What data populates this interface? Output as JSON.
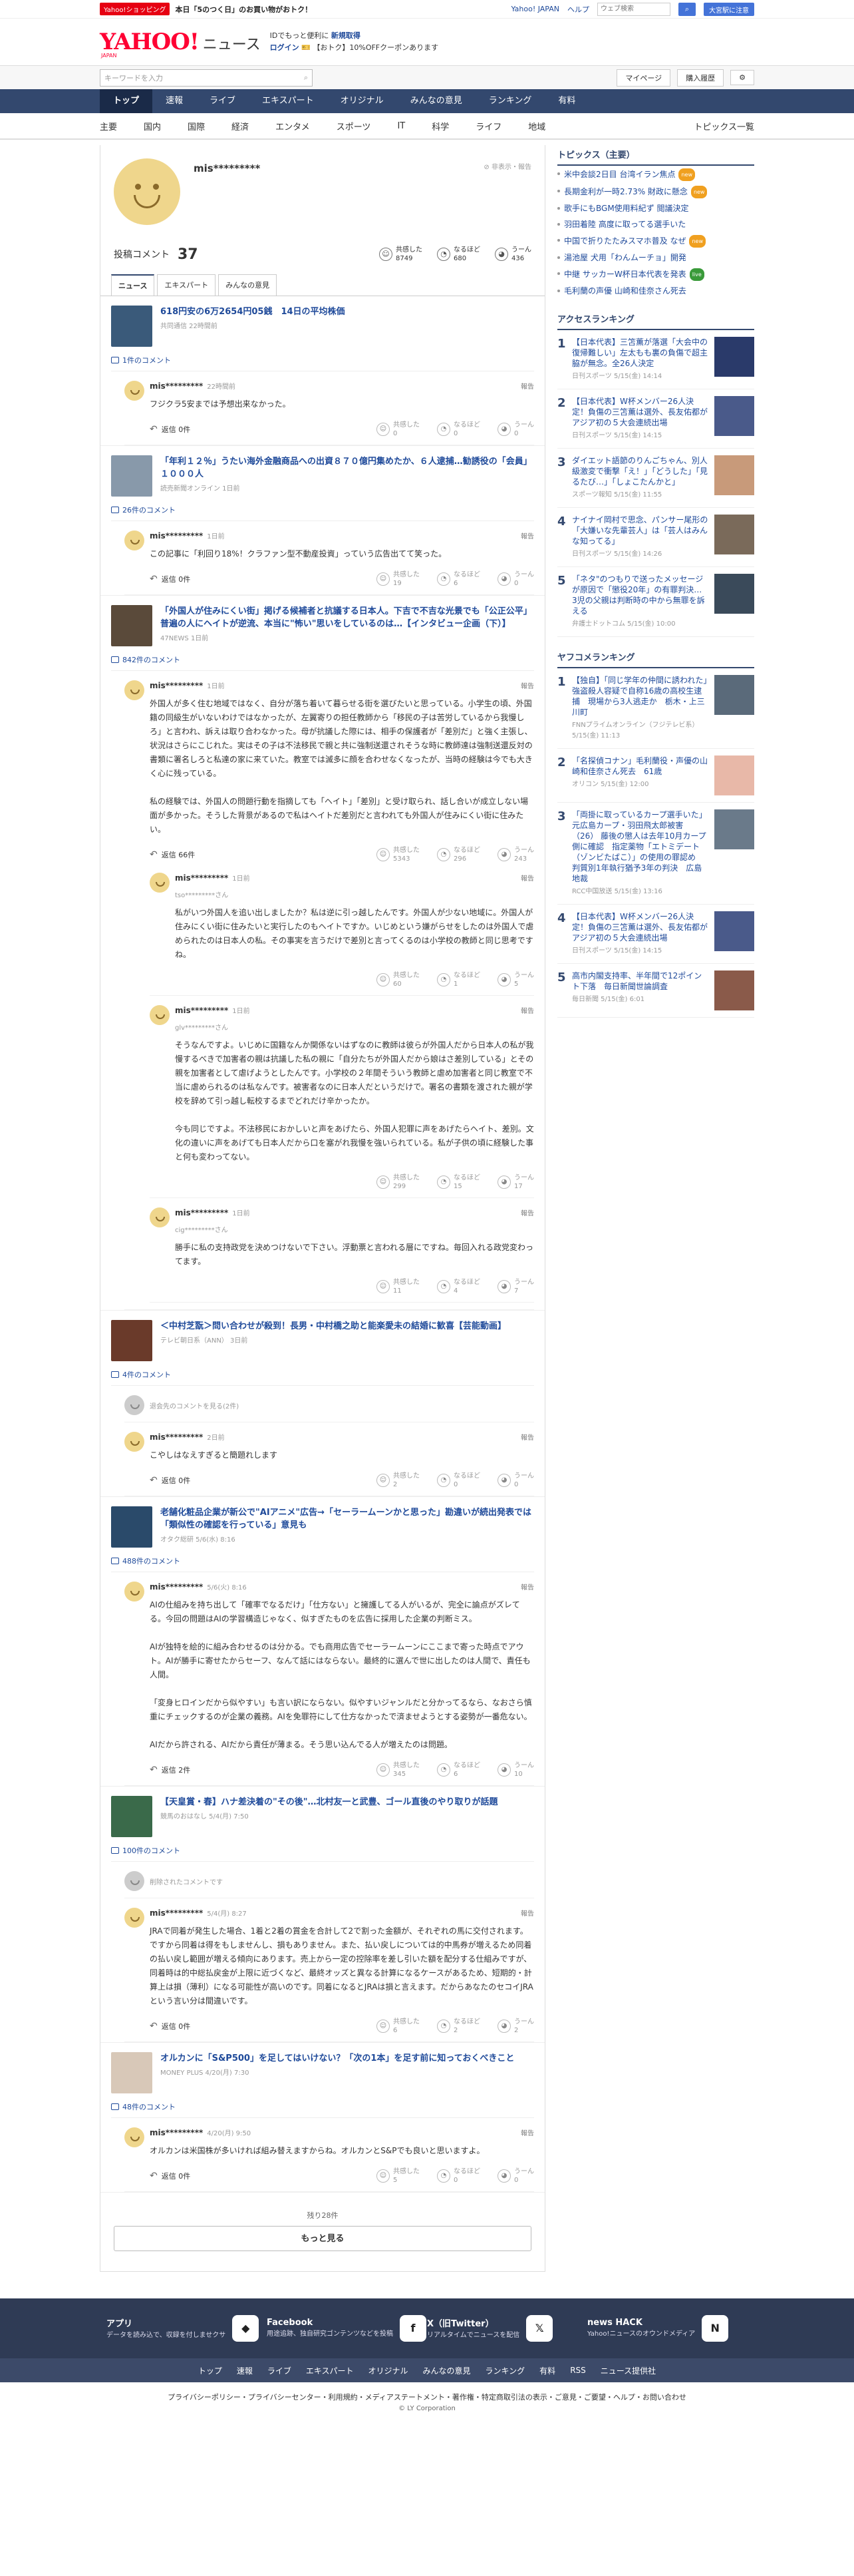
{
  "topbar": {
    "badge": "Yahoo!ショッピング",
    "promo": "本日「5のつく日」のお買い物がおトク！",
    "links": [
      "Yahoo! JAPAN",
      "ヘルプ"
    ],
    "search_placeholder": "ウェブ検索",
    "mail_btn": "大宮駅に注意"
  },
  "header": {
    "logo": "YAHOO!",
    "logo_jp": "JAPAN",
    "logo_sub": "ニュース",
    "promo1": "IDでもっと便利に",
    "promo1_link": "新規取得",
    "promo2": "ログイン",
    "promo2_rest": "【おトク】10%OFFクーポンあります"
  },
  "search": {
    "placeholder": "キーワードを入力",
    "links": [
      "マイページ",
      "購入履歴"
    ]
  },
  "gnav": [
    "トップ",
    "速報",
    "ライブ",
    "エキスパート",
    "オリジナル",
    "みんなの意見",
    "ランキング",
    "有料"
  ],
  "subnav": [
    "主要",
    "国内",
    "国際",
    "経済",
    "エンタメ",
    "スポーツ",
    "IT",
    "科学",
    "ライフ",
    "地域"
  ],
  "subnav_right": "トピックス一覧",
  "profile": {
    "name": "mis*********",
    "meta": "非表示・報告",
    "comment_label": "投稿コメント",
    "comment_count": "37",
    "reactions": [
      {
        "icon": "☺",
        "label": "共感した",
        "value": "8749"
      },
      {
        "icon": "◔",
        "label": "なるほど",
        "value": "680"
      },
      {
        "icon": "◕",
        "label": "うーん",
        "value": "436"
      }
    ],
    "tabs": [
      "ニュース",
      "エキスパート",
      "みんなの意見"
    ]
  },
  "articles": [
    {
      "title": "618円安の6万2654円05銭　14日の平均株価",
      "source": "共同通信 22時間前",
      "thumb": "#3a5a7a",
      "comment_count": "1件のコメント",
      "comments": [
        {
          "user": "mis*********",
          "time": "22時間前",
          "text": "フジクラ5安までは予想出来なかった。",
          "r": [
            "0",
            "0",
            "0"
          ],
          "reply": "返信 0件"
        }
      ]
    },
    {
      "title": "「年利１２％」うたい海外金融商品への出資８７０億円集めたか、６人逮捕…勧誘役の「会員」１０００人",
      "source": "読売新聞オンライン 1日前",
      "thumb": "#8899aa",
      "comment_count": "26件のコメント",
      "comments": [
        {
          "user": "mis*********",
          "time": "1日前",
          "text": "この記事に「利回り18%！クラファン型不動産投資」っていう広告出てて笑った。",
          "r": [
            "19",
            "6",
            "0"
          ],
          "reply": "返信 0件"
        }
      ]
    },
    {
      "title": "「外国人が住みにくい街」掲げる候補者と抗議する日本人。下吉で不吉な光景でも「公正公平」普遍の人にヘイトが逆流、本当に\"怖い\"思いをしているのは…【インタビュー企画（下）】",
      "source": "47NEWS 1日前",
      "thumb": "#5a4a3a",
      "comment_count": "842件のコメント",
      "comments": [
        {
          "user": "mis*********",
          "time": "1日前",
          "text": "外国人が多く住む地域ではなく、自分が落ち着いて暮らせる街を選びたいと思っている。小学生の頃、外国籍の同級生がいないわけではなかったが、左翼寄りの担任教師から「移民の子は苦労しているから我慢しろ」と言われ、訴えは取り合わなかった。母が抗議した際には、相手の保護者が「差別だ」と強く主張し、状況はさらにこじれた。実はその子は不法移民で親と共に強制送還されそうな時に教師達は強制送還反対の書類に署名しろと私達の家に来ていた。教室では滅多に顔を合わせなくなったが、当時の経験は今でも大きく心に残っている。\n\n私の経験では、外国人の問題行動を指摘しても「ヘイト」「差別」と受け取られ、話し合いが成立しない場面が多かった。そうした背景があるので私はヘイトだ差別だと言われても外国人が住みにくい街に住みたい。",
          "r": [
            "5343",
            "296",
            "243"
          ],
          "reply": "返信 66件",
          "replies": [
            {
              "user": "tso*********さん",
              "text": "私がいつ外国人を追い出しましたか？私は逆に引っ越したんです。外国人が少ない地域に。外国人が住みにくい街に住みたいと実行したのもヘイトですか。いじめという嫌がらせをしたのは外国人で虐められたのは日本人の私。その事実を言うだけで差別と言ってくるのは小学校の教師と同じ思考ですね。",
              "r": [
                "60",
                "1",
                "5"
              ]
            },
            {
              "user": "glv*********さん",
              "text": "そうなんですよ。いじめに国籍なんか関係ないはずなのに教師は彼らが外国人だから日本人の私が我慢するべきで加害者の親は抗議した私の親に「自分たちが外国人だから娘はさ差別している」とその親を加害者として虐げようとしたんです。小学校の２年間そういう教師と虐め加害者と同じ教室で不当に虐められるのは私なんです。被害者なのに日本人だというだけで。署名の書類を渡された親が学校を辞めて引っ越し転校するまでどれだけ辛かったか。\n\n今も同じですよ。不法移民におかしいと声をあげたら、外国人犯罪に声をあげたらヘイト、差別。文化の違いに声をあげても日本人だから口を塞がれ我慢を強いられている。私が子供の頃に経験した事と何も変わってない。",
              "r": [
                "299",
                "15",
                "17"
              ]
            },
            {
              "user": "cig*********さん",
              "text": "勝手に私の支持政党を決めつけないで下さい。浮動票と言われる層にですね。毎回入れる政党変わってます。",
              "r": [
                "11",
                "4",
                "7"
              ]
            }
          ]
        }
      ]
    },
    {
      "title": "＜中村芝翫＞問い合わせが殺到！長男・中村橋之助と能楽愛未の結婚に歓喜【芸能動画】",
      "source": "テレビ朝日系（ANN） 3日前",
      "thumb": "#6a3a2a",
      "comment_count": "4件のコメント",
      "deleted": "退会先のコメントを見る(2件)",
      "comments": [
        {
          "user": "mis*********",
          "time": "2日前",
          "text": "こやしはなえすぎると簡題れします",
          "r": [
            "2",
            "0",
            "0"
          ],
          "reply": "返信 0件"
        }
      ]
    },
    {
      "title": "老舗化粧品企業が新公で\"AIアニメ\"広告→「セーラームーンかと思った」勘違いが続出発表では「類似性の確認を行っている」意見も",
      "source": "オタク総研 5/6(水) 8:16",
      "thumb": "#2a4a6a",
      "comment_count": "488件のコメント",
      "comments": [
        {
          "user": "mis*********",
          "time": "5/6(火) 8:16",
          "text": "AIの仕組みを持ち出して「確率でなるだけ」「仕方ない」と擁護してる人がいるが、完全に論点がズレてる。今回の問題はAIの学習構造じゃなく、似すぎたものを広告に採用した企業の判断ミス。\n\nAIが独特を絵的に組み合わせるのは分かる。でも商用広告でセーラームーンにここまで寄った時点でアウト。AIが勝手に寄せたからセーフ、なんて話にはならない。最終的に選んで世に出したのは人間で、責任も人間。\n\n「変身ヒロインだから似やすい」も言い訳にならない。似やすいジャンルだと分かってるなら、なおさら慎重にチェックするのが企業の義務。AIを免罪符にして仕方なかったで済ませようとする姿勢が一番危ない。\n\nAIだから許される、AIだから責任が薄まる。そう思い込んでる人が増えたのは問題。",
          "r": [
            "345",
            "6",
            "10"
          ],
          "reply": "返信 2件"
        }
      ]
    },
    {
      "title": "【天皇賞・春】ハナ差決着の\"その後\"…北村友一と武豊、ゴール直後のやり取りが話題",
      "source": "競馬のおはなし 5/4(月) 7:50",
      "thumb": "#3a6a4a",
      "comment_count": "100件のコメント",
      "deleted": "削除されたコメントです",
      "comments": [
        {
          "user": "mis*********",
          "time": "5/4(月) 8:27",
          "text": "JRAで同着が発生した場合、1着と2着の賞金を合計して2で割った金額が、それぞれの馬に交付されます。ですから同着は得をもしませんし、損もありません。また、払い戻しについては的中馬券が増えるため同着の払い戻し範囲が増える傾向にあります。売上から一定の控除率を差し引いた額を配分する仕組みですが、同着時は的中総払戻金が上限に近づくなど、最終オッズと異なる計算になるケースがあるため、短期的・計算上は損（薄利）になる可能性が高いのです。同着になるとJRAは損と言えます。だからあなたのセコイJRAという言い分は間違いです。",
          "r": [
            "6",
            "2",
            "2"
          ],
          "reply": "返信 0件"
        }
      ]
    },
    {
      "title": "オルカンに「S&P500」を足してはいけない？「次の1本」を足す前に知っておくべきこと",
      "source": "MONEY PLUS 4/20(月) 7:30",
      "thumb": "#d8c8b8",
      "comment_count": "48件のコメント",
      "comments": [
        {
          "user": "mis*********",
          "time": "4/20(月) 9:50",
          "text": "オルカンは米国株が多いければ組み替えますからね。オルカンとS&Pでも良いと思いますよ。",
          "r": [
            "5",
            "0",
            "0"
          ],
          "reply": "返信 0件"
        }
      ]
    }
  ],
  "more": {
    "rest": "残り28件",
    "button": "もっと見る"
  },
  "side": {
    "topics_title": "トピックス（主要）",
    "topics": [
      {
        "t": "米中会談2日目 台湾イラン焦点",
        "b": "new",
        "c": "#f0a020"
      },
      {
        "t": "長期金利が一時2.73% 財政に懸念",
        "b": "new",
        "c": "#f0a020"
      },
      {
        "t": "歌手にもBGM使用料紀ず 閲議決定",
        "b": "",
        "c": ""
      },
      {
        "t": "羽田着陸 高度に取ってる選手いた",
        "b": "",
        "c": ""
      },
      {
        "t": "中国で折りたたみスマホ普及 なぜ",
        "b": "new",
        "c": "#f0a020"
      },
      {
        "t": "湯池屋 犬用「わんムーチョ」開発",
        "b": "",
        "c": ""
      },
      {
        "t": "中継 サッカーW杯日本代表を発表",
        "b": "live",
        "c": "#3a9a3a"
      },
      {
        "t": "毛利蘭の声優 山崎和佳奈さん死去",
        "b": "",
        "c": ""
      }
    ],
    "access_title": "アクセスランキング",
    "access": [
      {
        "t": "【日本代表】三笘薫が落選「大会中の復帰難しい」左太もも裏の負傷で超主脇が無念。全26人決定",
        "s": "日刊スポーツ 5/15(金) 14:14",
        "c": "#2a3a6a"
      },
      {
        "t": "【日本代表】W杯メンバー26人決定！負傷の三笘薫は選外、長友佑都がアジア初の５大会連続出場",
        "s": "日刊スポーツ 5/15(金) 14:15",
        "c": "#4a5a8a"
      },
      {
        "t": "ダイエット語節のりんごちゃん、別人級激変で衝撃「え！」「どうした」「見るたび…」「しょこたんかと」",
        "s": "スポーツ報知 5/15(金) 11:55",
        "c": "#c89a7a"
      },
      {
        "t": "ナイナイ岡村で思念、パンサー尾形の「大嫌いな先輩芸人」は「芸人はみんな知ってる」",
        "s": "日刊スポーツ 5/15(金) 14:26",
        "c": "#7a6a5a"
      },
      {
        "t": "「ネタ\"のつもりで送ったメッセージが原因で「懲役20年」の有罪判決… 3児の父親は判断時の中から無罪を訴える",
        "s": "弁護士ドットコム 5/15(金) 10:00",
        "c": "#3a4a5a"
      }
    ],
    "yahoo_title": "ヤフコメランキング",
    "yahoo": [
      {
        "t": "【独自】「同じ学年の仲間に誘われた」強盗殺人容疑で自称16歳の高校生逮捕　現場から3人逃走か　栃木・上三川町",
        "s": "FNNプライムオンライン（フジテレビ系） 5/15(金) 11:13",
        "c": "#5a6a7a"
      },
      {
        "t": "「名探偵コナン」毛利蘭役・声優の山崎和佳奈さん死去　61歳",
        "s": "オリコン 5/15(金) 12:00",
        "c": "#e8b8a8"
      },
      {
        "t": "「両掛に取っているカープ選手いた」元広島カープ・羽田飛太郎被害（26） 藤後の懲人は去年10月カープ側に確認　指定薬物「エトミデート（ゾンビたばこ）」の使用の罪認め　判質別1年執行猶予3年の判決　広島地裁",
        "s": "RCC中国放送 5/15(金) 13:16",
        "c": "#6a7a8a"
      },
      {
        "t": "【日本代表】W杯メンバー26人決定！負傷の三笘薫は選外、長友佑都がアジア初の５大会連続出場",
        "s": "日刊スポーツ 5/15(金) 14:15",
        "c": "#4a5a8a"
      },
      {
        "t": "高市内閣支持率、半年間で12ポイント下落　毎日新聞世論調査",
        "s": "毎日新聞 5/15(金) 6:01",
        "c": "#8a5a4a"
      }
    ]
  },
  "appbar": [
    {
      "t": "アプリ",
      "d": "データを読み込で、収録を付しませクサ",
      "i": "◆"
    },
    {
      "t": "Facebook",
      "d": "用途追跡、独自研究ゴンテンツなどを投稿",
      "i": "f"
    },
    {
      "t": "X（旧Twitter）",
      "d": "リアルタイムでニュースを配信",
      "i": "𝕏"
    },
    {
      "t": "news HACK",
      "d": "Yahoo!ニュースのオウンドメディア",
      "i": "N"
    }
  ],
  "fnav": [
    "トップ",
    "速報",
    "ライブ",
    "エキスパート",
    "オリジナル",
    "みんなの意見",
    "ランキング",
    "有料",
    "RSS",
    "ニュース提供社"
  ],
  "flinks": "プライバシーポリシー・プライバシーセンター・利用規約・メディアステートメント・著作権・特定商取引法の表示・ご意見・ご要望・ヘルプ・お問い合わせ",
  "copy": "© LY Corporation"
}
